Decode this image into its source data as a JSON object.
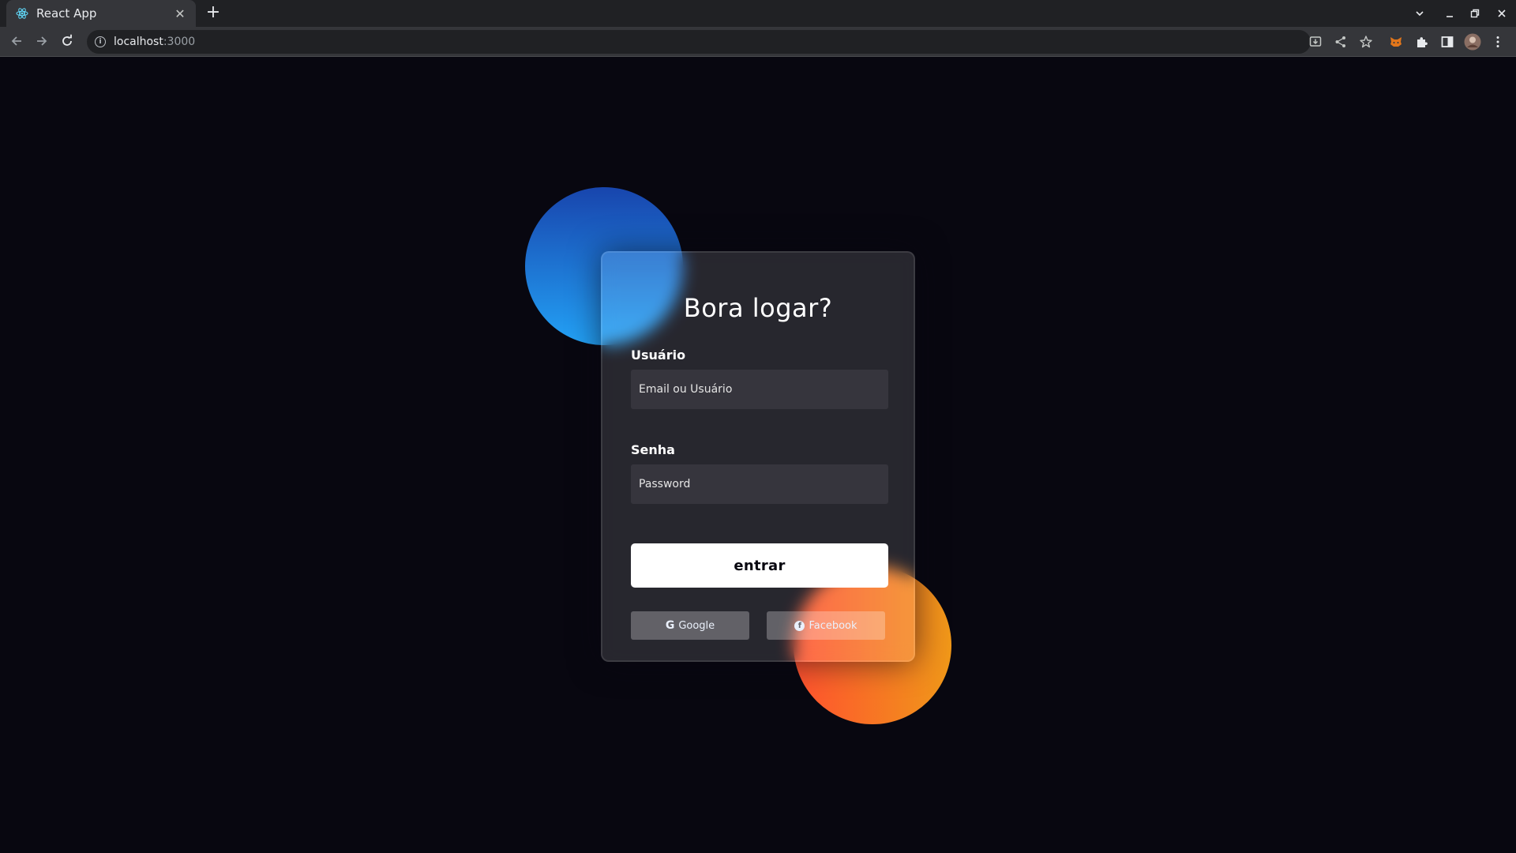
{
  "browser": {
    "tab": {
      "title": "React App",
      "favicon": "react-atom-icon",
      "close_glyph": "✕"
    },
    "new_tab_glyph": "+",
    "address": {
      "host": "localhost",
      "port": ":3000"
    },
    "window_controls": {
      "tab_search": "⌄",
      "minimize": "–",
      "restore": "❐",
      "close": "✕"
    },
    "toolbar_icons": [
      "install-icon",
      "share-icon",
      "bookmark-star-icon",
      "metamask-extension-icon",
      "extensions-puzzle-icon",
      "side-panel-icon",
      "profile-avatar",
      "menu-kebab-icon"
    ]
  },
  "login": {
    "title": "Bora logar?",
    "username": {
      "label": "Usuário",
      "placeholder": "Email ou Usuário",
      "value": ""
    },
    "password": {
      "label": "Senha",
      "placeholder": "Password",
      "value": ""
    },
    "submit_label": "entrar",
    "social": {
      "google": {
        "label": "Google",
        "glyph": "G"
      },
      "facebook": {
        "label": "Facebook",
        "glyph": "f"
      }
    }
  },
  "colors": {
    "page_background": "#080710",
    "blue_gradient": [
      "#1845ad",
      "#23a2f6"
    ],
    "orange_gradient": [
      "#ff512f",
      "#f09819"
    ],
    "submit_background": "#ffffff"
  }
}
